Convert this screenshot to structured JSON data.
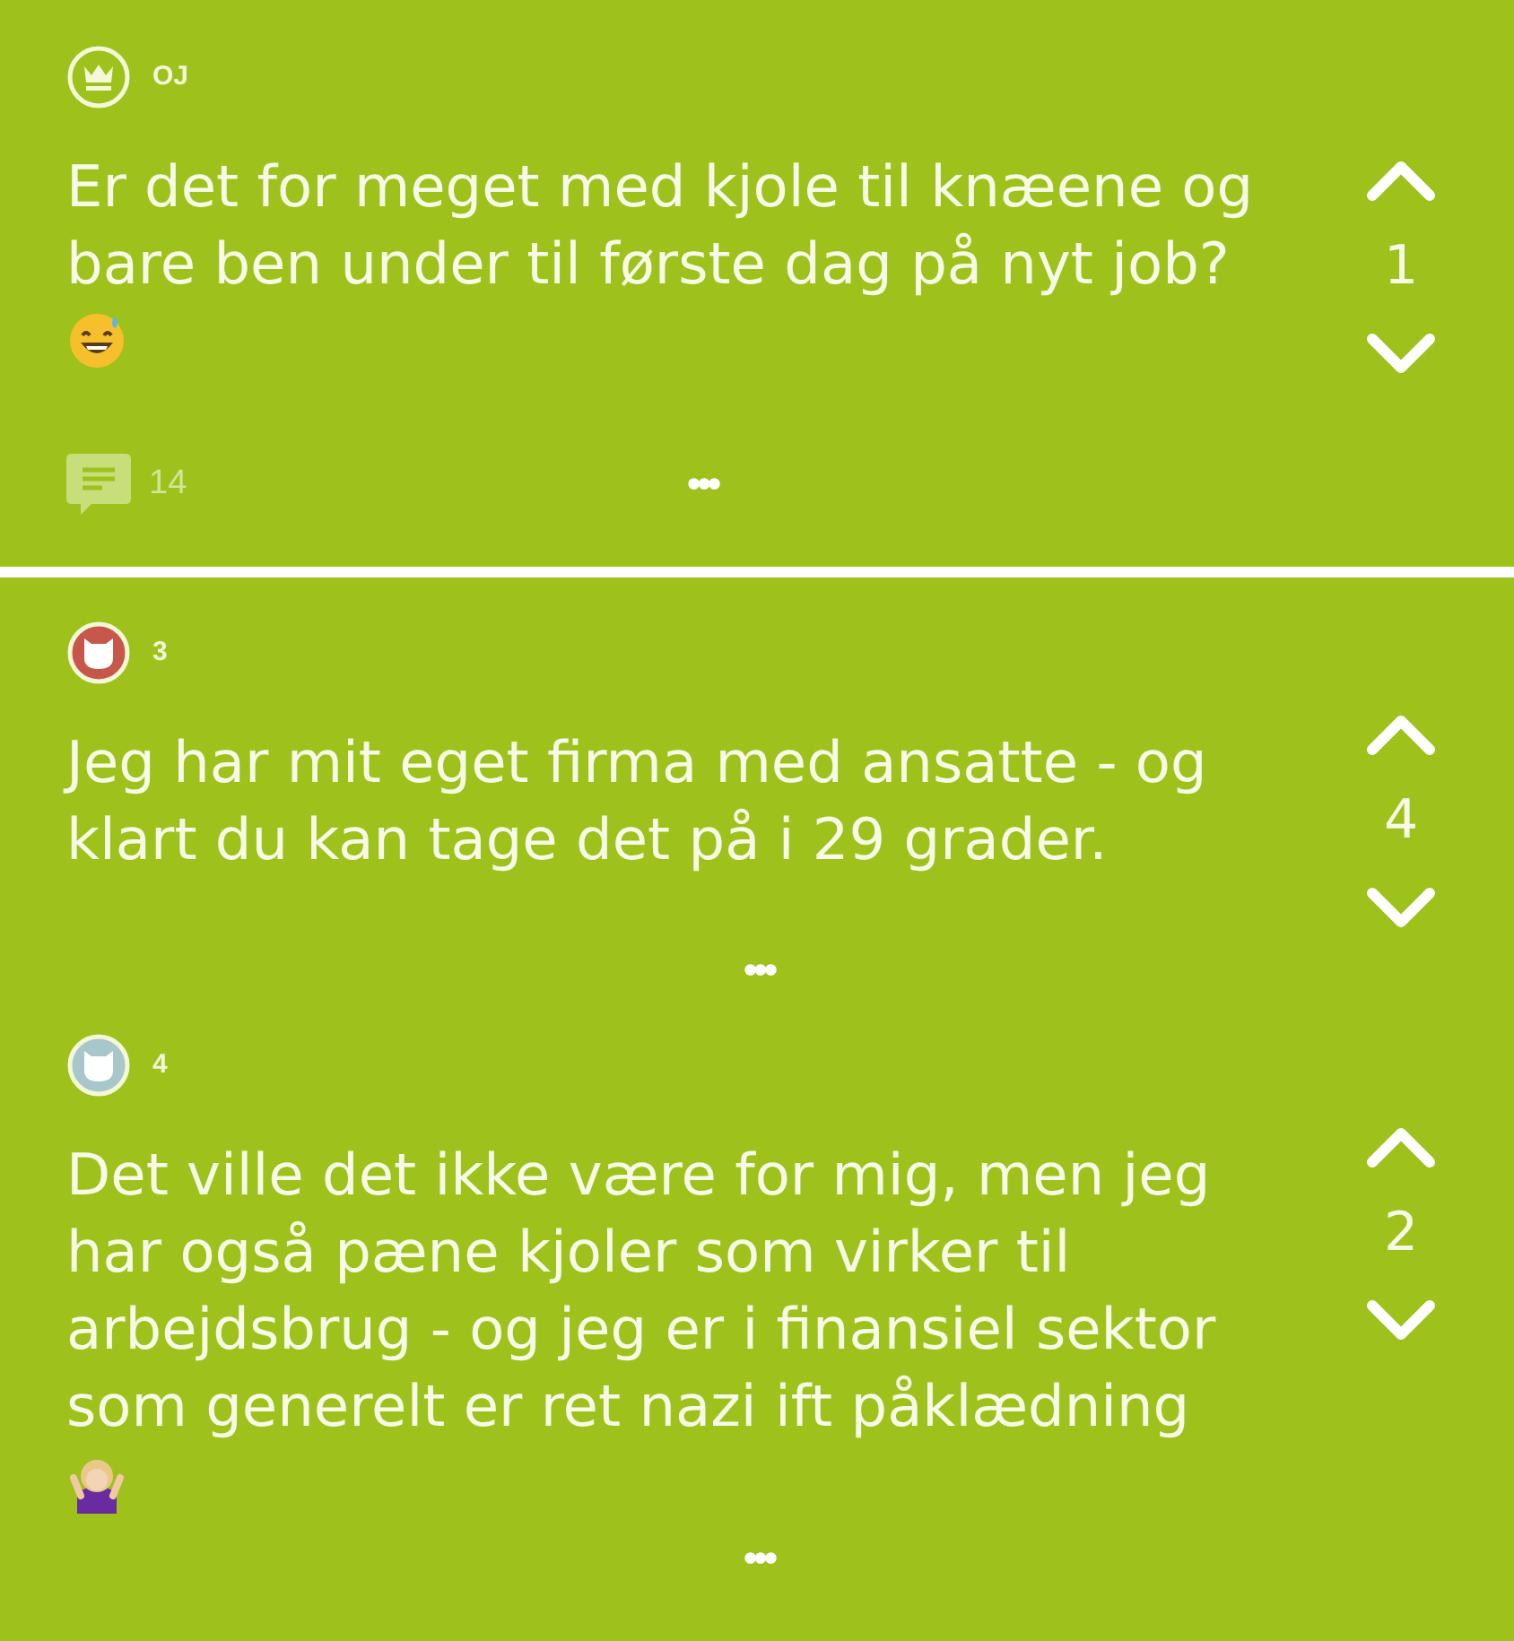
{
  "post": {
    "avatar": {
      "kind": "crown"
    },
    "name": "OJ",
    "text": "Er det for meget med kjole til knæene og bare ben under til første dag på nyt job?",
    "trailing_icon": {
      "kind": "smiley"
    },
    "votes": "1",
    "comments": "14",
    "more": "•••"
  },
  "replies": [
    {
      "avatar": {
        "kind": "cat",
        "color": "#c8574b"
      },
      "name": "3",
      "text": "Jeg har mit eget firma med ansatte - og klart du kan tage det på i 29 grader.",
      "votes": "4",
      "more": "•••"
    },
    {
      "avatar": {
        "kind": "cat",
        "color": "#a8c7cb"
      },
      "name": "4",
      "text": "Det ville det ikke være for mig, men jeg har også pæne kjoler som virker til arbejdsbrug - og jeg er i finansiel sektor som generelt er ret nazi ift påklædning",
      "trailing_icon": {
        "kind": "shrug"
      },
      "votes": "2",
      "more": "•••"
    }
  ]
}
